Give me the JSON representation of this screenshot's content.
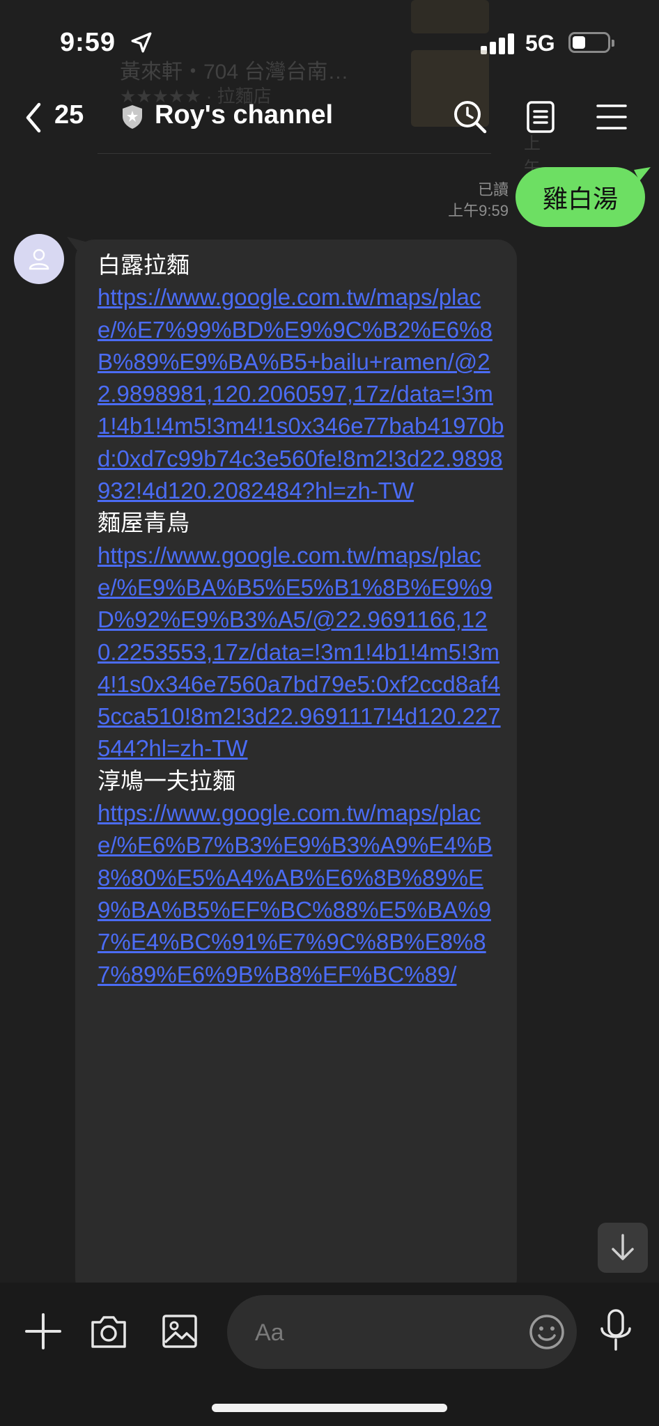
{
  "status_bar": {
    "time": "9:59",
    "network": "5G",
    "battery_level": 0.35
  },
  "background_preview": {
    "place_line": "黃來軒・704 台灣台南…",
    "rating_line": "★★★★★ · 拉麵店",
    "time_line": "上午 9:59"
  },
  "header": {
    "back_count": "25",
    "title": "Roy's channel",
    "icons": [
      "back-chevron-icon",
      "shield-icon",
      "search-icon",
      "notes-icon",
      "menu-icon"
    ]
  },
  "chat": {
    "outgoing": {
      "read_label": "已讀",
      "timestamp": "上午9:59",
      "text": "雞白湯"
    },
    "incoming": {
      "lines": [
        {
          "type": "name",
          "text": "白露拉麵"
        },
        {
          "type": "url",
          "text": "https://www.google.com.tw/maps/place/%E7%99%BD%E9%9C%B2%E6%8B%89%E9%BA%B5+bailu+ramen/@22.9898981,120.2060597,17z/data=!3m1!4b1!4m5!3m4!1s0x346e77bab41970bd:0xd7c99b74c3e560fe!8m2!3d22.9898932!4d120.2082484?hl=zh-TW"
        },
        {
          "type": "name",
          "text": "麵屋青鳥"
        },
        {
          "type": "url",
          "text": "https://www.google.com.tw/maps/place/%E9%BA%B5%E5%B1%8B%E9%9D%92%E9%B3%A5/@22.9691166,120.2253553,17z/data=!3m1!4b1!4m5!3m4!1s0x346e7560a7bd79e5:0xf2ccd8af45cca510!8m2!3d22.9691117!4d120.227544?hl=zh-TW"
        },
        {
          "type": "name",
          "text": "淳鳩一夫拉麵"
        },
        {
          "type": "url",
          "text": "https://www.google.com.tw/maps/place/%E6%B7%B3%E9%B3%A9%E4%B8%80%E5%A4%AB%E6%8B%89%E9%BA%B5%EF%BC%88%E5%BA%97%E4%BC%91%E7%9C%8B%E8%87%89%E6%9B%B8%EF%BC%89/"
        }
      ]
    }
  },
  "input_bar": {
    "placeholder": "Aa",
    "icons": [
      "plus-icon",
      "camera-icon",
      "image-icon",
      "emoji-icon",
      "microphone-icon"
    ]
  },
  "colors": {
    "background": "#1f1f1f",
    "outgoing_bubble": "#6ddf63",
    "incoming_bubble": "#2c2c2c",
    "link": "#4b6cf5"
  }
}
